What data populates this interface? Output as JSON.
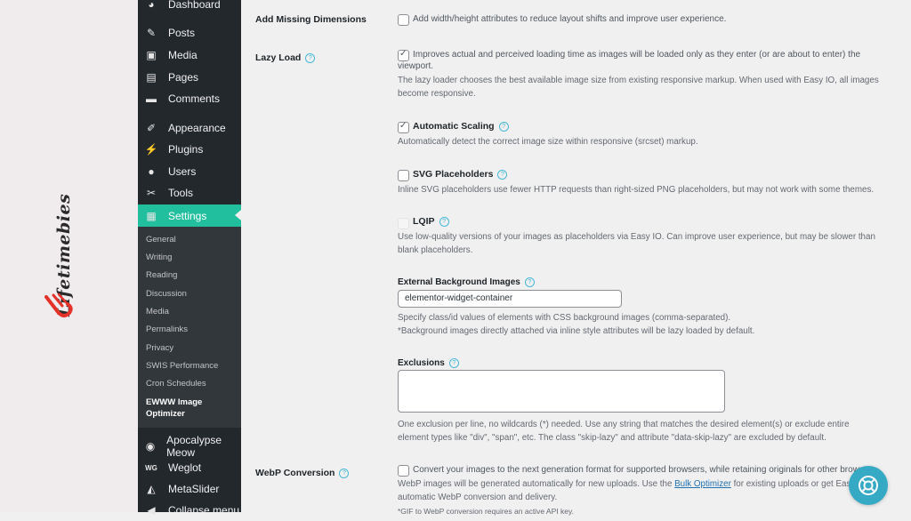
{
  "brand": {
    "name": "Lifetimebies",
    "accent": "#e4322b"
  },
  "sidebar": {
    "items": [
      {
        "label": "Dashboard",
        "icon": "dashboard-icon"
      },
      {
        "label": "Posts",
        "icon": "pin-icon"
      },
      {
        "label": "Media",
        "icon": "media-icon"
      },
      {
        "label": "Pages",
        "icon": "pages-icon"
      },
      {
        "label": "Comments",
        "icon": "comment-icon"
      },
      {
        "label": "Appearance",
        "icon": "brush-icon"
      },
      {
        "label": "Plugins",
        "icon": "plug-icon"
      },
      {
        "label": "Users",
        "icon": "user-icon"
      },
      {
        "label": "Tools",
        "icon": "wrench-icon"
      },
      {
        "label": "Settings",
        "icon": "settings-icon",
        "active": true
      }
    ],
    "settings_submenu": [
      "General",
      "Writing",
      "Reading",
      "Discussion",
      "Media",
      "Permalinks",
      "Privacy",
      "SWIS Performance",
      "Cron Schedules"
    ],
    "current_submenu": {
      "line1": "EWWW Image",
      "line2": "Optimizer"
    },
    "plugins": [
      {
        "label": "Apocalypse Meow",
        "icon": "cat-icon"
      },
      {
        "label": "Weglot",
        "icon": "weglot-icon"
      },
      {
        "label": "MetaSlider",
        "icon": "metaslider-icon"
      },
      {
        "label": "Collapse menu",
        "icon": "collapse-icon"
      }
    ],
    "active_color": "#21bf9e"
  },
  "settings": {
    "add_missing_dimensions": {
      "label": "Add Missing Dimensions",
      "checked": false,
      "text": "Add width/height attributes to reduce layout shifts and improve user experience."
    },
    "lazy_load": {
      "label": "Lazy Load",
      "checked": true,
      "text_line1": "Improves actual and perceived loading time as images will be loaded only as they enter (or are about to enter) the",
      "text_line2": "viewport.",
      "desc_line1": "The lazy loader chooses the best available image size from existing responsive markup. When used with Easy IO, all images",
      "desc_line2": "become responsive."
    },
    "automatic_scaling": {
      "label": "Automatic Scaling",
      "checked": true,
      "desc": "Automatically detect the correct image size within responsive (srcset) markup."
    },
    "svg_placeholders": {
      "label": "SVG Placeholders",
      "checked": false,
      "desc": "Inline SVG placeholders use fewer HTTP requests than right-sized PNG placeholders, but may not work with some themes."
    },
    "lqip": {
      "label": "LQIP",
      "checked": false,
      "disabled": true,
      "desc_line1": "Use low-quality versions of your images as placeholders via Easy IO. Can improve user experience, but may be slower than",
      "desc_line2": "blank placeholders."
    },
    "external_bg": {
      "label": "External Background Images",
      "value": "elementor-widget-container",
      "desc_line1": "Specify class/id values of elements with CSS background images (comma-separated).",
      "desc_line2": "*Background images directly attached via inline style attributes will be lazy loaded by default."
    },
    "exclusions": {
      "label": "Exclusions",
      "value": "",
      "desc_line1": "One exclusion per line, no wildcards (*) needed. Use any string that matches the desired element(s) or exclude entire",
      "desc_line2": "element types like \"div\", \"span\", etc. The class \"skip-lazy\" and attribute \"data-skip-lazy\" are excluded by default."
    },
    "webp": {
      "label": "WebP Conversion",
      "checked": false,
      "text": "Convert your images to the next generation format for supported browsers, while retaining originals for other browsers.",
      "desc_before": "WebP images will be generated automatically for new uploads. Use the ",
      "desc_link": "Bulk Optimizer",
      "desc_after": " for existing uploads or get Easy IO for",
      "desc_line2": "automatic WebP conversion and delivery.",
      "desc_line3": "*GIF to WebP conversion requires an active API key."
    }
  },
  "help_button": {
    "icon": "lifebuoy-icon",
    "color": "#36a9c4"
  }
}
